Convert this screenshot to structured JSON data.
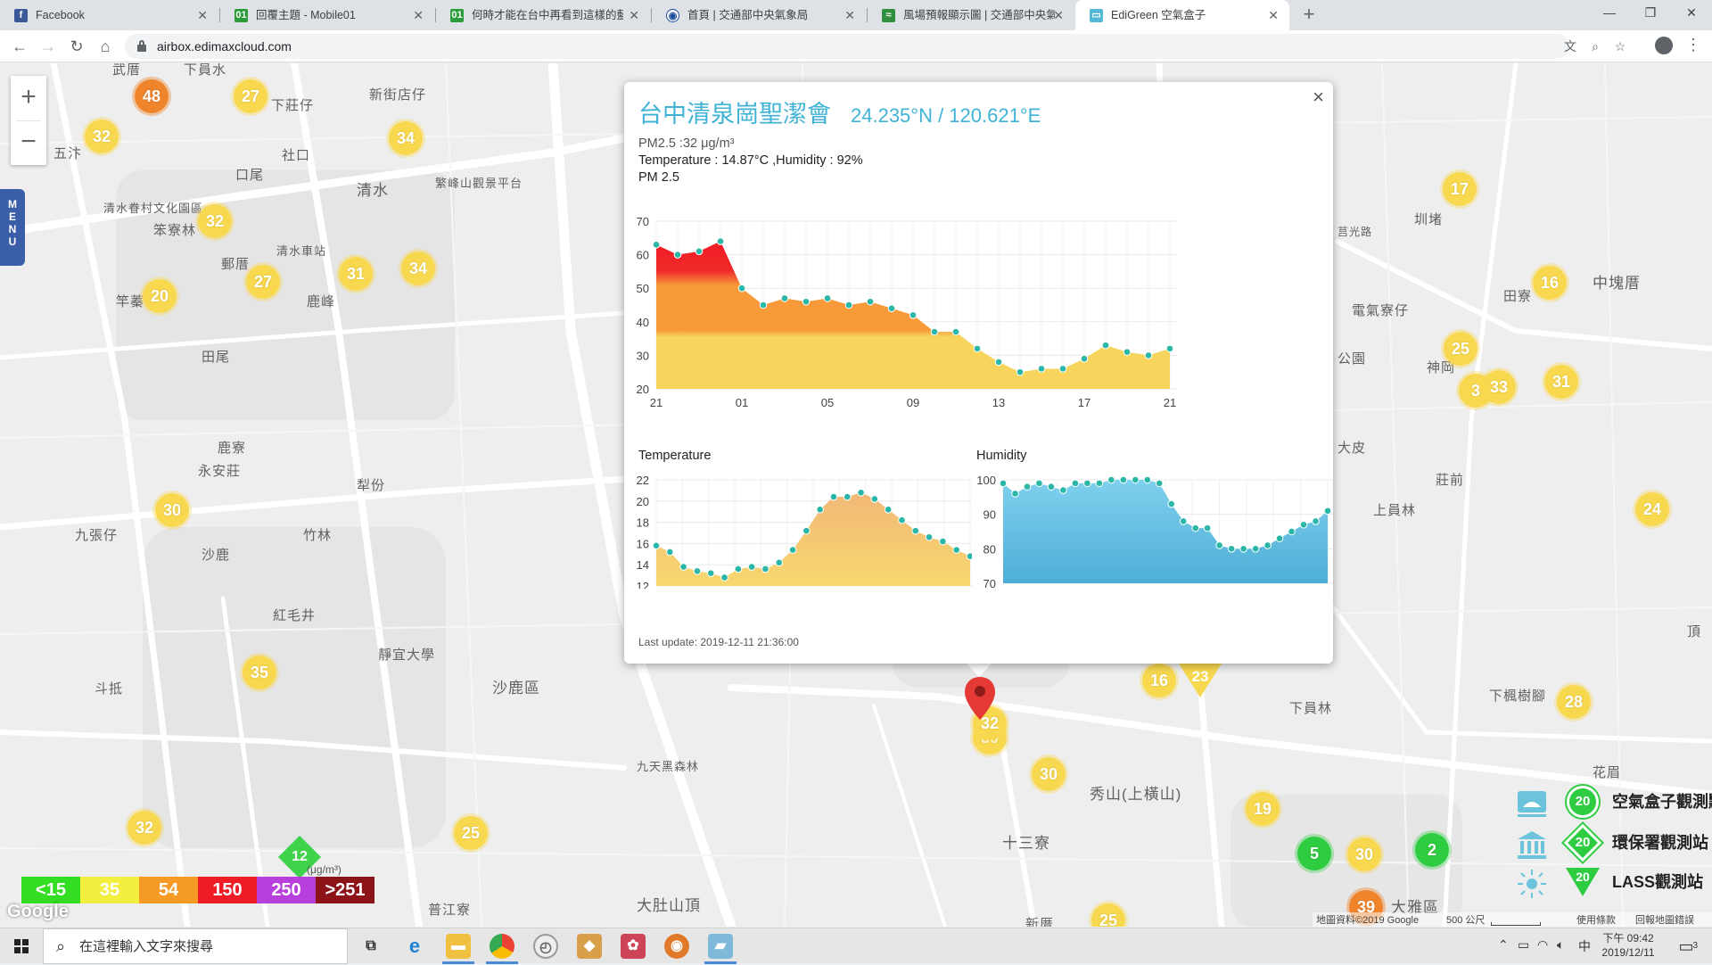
{
  "browser": {
    "tabs": [
      {
        "label": "Facebook",
        "icon": "facebook-icon",
        "active": false
      },
      {
        "label": "回覆主題 - Mobile01",
        "icon": "mobile01-icon",
        "active": false
      },
      {
        "label": "何時才能在台中再看到這樣的藍天",
        "icon": "mobile01-icon",
        "active": false
      },
      {
        "label": "首頁 | 交通部中央氣象局",
        "icon": "cwb-icon",
        "active": false
      },
      {
        "label": "風場預報顯示圖 | 交通部中央氣象局",
        "icon": "wind-icon",
        "active": false
      },
      {
        "label": "EdiGreen 空氣盒子",
        "icon": "edigreen-icon",
        "active": true
      }
    ],
    "url": "airbox.edimaxcloud.com"
  },
  "map": {
    "zoom_in": "+",
    "zoom_out": "−",
    "menu_label": "MENU",
    "places": [
      {
        "text": "下員水"
      },
      {
        "text": "下莊仔"
      },
      {
        "text": "新街店仔"
      },
      {
        "text": "社口"
      },
      {
        "text": "口尾"
      },
      {
        "text": "清水"
      },
      {
        "text": "清水眷村文化園區"
      },
      {
        "text": "笨寮林"
      },
      {
        "text": "郵厝"
      },
      {
        "text": "清水車站"
      },
      {
        "text": "鹿峰"
      },
      {
        "text": "田尾"
      },
      {
        "text": "鹿寮"
      },
      {
        "text": "永安莊"
      },
      {
        "text": "犁份"
      },
      {
        "text": "九張仔"
      },
      {
        "text": "沙鹿"
      },
      {
        "text": "竹林"
      },
      {
        "text": "沙鹿區"
      },
      {
        "text": "紅毛井"
      },
      {
        "text": "斗抵"
      },
      {
        "text": "靜宜大學"
      },
      {
        "text": "普江寮"
      },
      {
        "text": "大肚山頂"
      },
      {
        "text": "九天黑森林"
      },
      {
        "text": "秀山(上橫山)"
      },
      {
        "text": "十三寮"
      },
      {
        "text": "新厝"
      },
      {
        "text": "下員林"
      },
      {
        "text": "下楓樹腳"
      },
      {
        "text": "花眉"
      },
      {
        "text": "大雅區"
      },
      {
        "text": "上員林"
      },
      {
        "text": "莊前"
      },
      {
        "text": "田寮"
      },
      {
        "text": "中塊厝"
      },
      {
        "text": "圳堵"
      },
      {
        "text": "電氣寮仔"
      },
      {
        "text": "神岡"
      },
      {
        "text": "繁峰山觀景平台"
      },
      {
        "text": "公園"
      },
      {
        "text": "頂"
      },
      {
        "text": "大皮"
      },
      {
        "text": "五汴"
      },
      {
        "text": "武厝"
      },
      {
        "text": "竿蓁"
      },
      {
        "text": "莒光路"
      }
    ],
    "airbox_markers": [
      {
        "value": "48",
        "color": "orange"
      },
      {
        "value": "27"
      },
      {
        "value": "32"
      },
      {
        "value": "34"
      },
      {
        "value": "32"
      },
      {
        "value": "31"
      },
      {
        "value": "34"
      },
      {
        "value": "27"
      },
      {
        "value": "20"
      },
      {
        "value": "30"
      },
      {
        "value": "35"
      },
      {
        "value": "32"
      },
      {
        "value": "25"
      },
      {
        "value": "16"
      },
      {
        "value": "30"
      },
      {
        "value": "30"
      },
      {
        "value": "19"
      },
      {
        "value": "30"
      },
      {
        "value": "39",
        "color": "orange"
      },
      {
        "value": "25"
      },
      {
        "value": "28"
      },
      {
        "value": "17"
      },
      {
        "value": "16"
      },
      {
        "value": "25"
      },
      {
        "value": "33"
      },
      {
        "value": "3"
      },
      {
        "value": "31"
      },
      {
        "value": "24"
      },
      {
        "value": "32"
      }
    ],
    "green_markers": [
      {
        "value": "5"
      },
      {
        "value": "2"
      }
    ],
    "lass_markers": [
      {
        "value": "23"
      }
    ],
    "epa_markers": [
      {
        "value": "12"
      }
    ],
    "pm_legend": [
      {
        "label": "<15",
        "color": "#33dd22"
      },
      {
        "label": "35",
        "color": "#f3ef40"
      },
      {
        "label": "54",
        "color": "#f59a25"
      },
      {
        "label": "150",
        "color": "#ee1c25"
      },
      {
        "label": "250",
        "color": "#b83fdc"
      },
      {
        "label": ">251",
        "color": "#8c1318"
      }
    ],
    "pm_unit": "(μg/m³)",
    "google_logo": "Google",
    "station_legend": [
      {
        "value": "20",
        "label": "空氣盒子觀測點"
      },
      {
        "value": "20",
        "label": "環保署觀測站"
      },
      {
        "value": "20",
        "label": "LASS觀測站"
      }
    ],
    "footer": {
      "data": "地圖資料©2019 Google",
      "scale": "500 公尺",
      "terms": "使用條款",
      "report": "回報地圖錯誤"
    }
  },
  "popup": {
    "title": "台中清泉崗聖潔會",
    "coords": "24.235°N / 120.621°E",
    "pm_reading": "PM2.5 :32 μg/m³",
    "temp_humidity": "Temperature : 14.87°C ,Humidity : 92%",
    "pm_chart_title": "PM 2.5",
    "temp_chart_title": "Temperature",
    "hum_chart_title": "Humidity",
    "last_update": "Last update: 2019-12-11 21:36:00",
    "close": "×"
  },
  "chart_data": [
    {
      "type": "area",
      "title": "PM 2.5",
      "x_ticks": [
        "21",
        "01",
        "05",
        "09",
        "13",
        "17",
        "21"
      ],
      "ylim": [
        20,
        70
      ],
      "y_ticks": [
        20,
        30,
        40,
        50,
        60,
        70
      ],
      "values": [
        63,
        60,
        61,
        64,
        50,
        45,
        47,
        46,
        47,
        45,
        46,
        44,
        42,
        37,
        37,
        32,
        28,
        25,
        26,
        26,
        29,
        33,
        31,
        30,
        32
      ]
    },
    {
      "type": "area",
      "title": "Temperature",
      "ylim": [
        12,
        22
      ],
      "y_ticks": [
        12,
        14,
        16,
        18,
        20,
        22
      ],
      "values": [
        15.8,
        15.2,
        13.8,
        13.4,
        13.2,
        12.8,
        13.6,
        13.8,
        13.6,
        14.2,
        15.4,
        17.2,
        19.2,
        20.4,
        20.4,
        20.8,
        20.2,
        19.2,
        18.2,
        17.2,
        16.6,
        16.2,
        15.4,
        14.8
      ]
    },
    {
      "type": "area",
      "title": "Humidity",
      "ylim": [
        70,
        100
      ],
      "y_ticks": [
        70,
        80,
        90,
        100
      ],
      "values": [
        99,
        96,
        98,
        99,
        98,
        97,
        99,
        99,
        99,
        100,
        100,
        100,
        100,
        99,
        93,
        88,
        86,
        86,
        81,
        80,
        80,
        80,
        81,
        83,
        85,
        87,
        88,
        91
      ]
    }
  ],
  "taskbar": {
    "search_placeholder": "在這裡輸入文字來搜尋",
    "time": "下午 09:42",
    "date": "2019/12/11",
    "ime": "中",
    "notifications": "3"
  }
}
